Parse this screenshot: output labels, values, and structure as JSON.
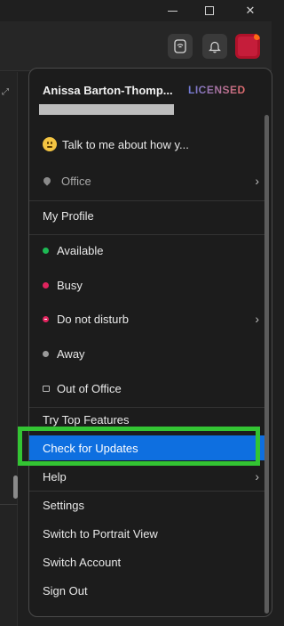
{
  "window": {
    "min_icon": "minimize-icon",
    "max_icon": "maximize-icon",
    "close_glyph": "✕"
  },
  "toolbar": {
    "cast_icon": "cast-icon",
    "bell_icon": "bell-icon"
  },
  "menu": {
    "profile_name": "Anissa Barton-Thomp...",
    "license": "LICENSED",
    "status_message": "Talk to me about how y...",
    "location": "Office",
    "my_profile": "My Profile",
    "presence": [
      {
        "label": "Available",
        "color": "#1db954"
      },
      {
        "label": "Busy",
        "color": "#e0245e"
      },
      {
        "label": "Do not disturb",
        "color": "#e0245e"
      },
      {
        "label": "Away",
        "color": "#9a9a9a"
      },
      {
        "label": "Out of Office",
        "color": "#bbbbbb"
      }
    ],
    "actions": [
      "Try Top Features",
      "Check for Updates",
      "Help",
      "Settings",
      "Switch to Portrait View",
      "Switch Account",
      "Sign Out"
    ],
    "chevron": "›"
  },
  "colors": {
    "accent": "#0e6fe0",
    "highlight_border": "#33c433"
  }
}
